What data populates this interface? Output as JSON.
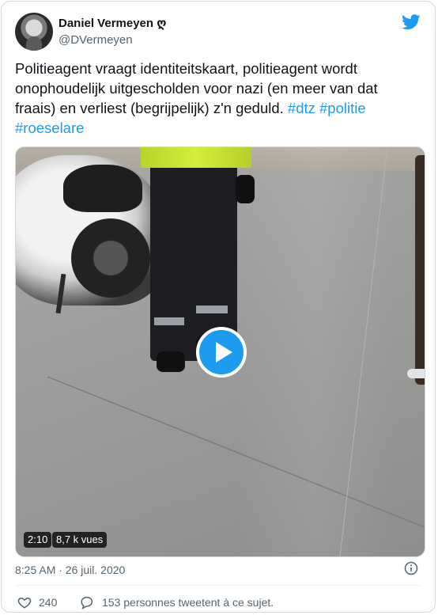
{
  "author": {
    "name": "Daniel Vermeyen",
    "name_glyph": "ღ",
    "handle": "@DVermeyen"
  },
  "tweet": {
    "text_lines": [
      "Politieagent vraagt identiteitskaart, politieagent wordt",
      "onophoudelijk uitgescholden voor nazi (en meer van dat",
      "fraais) en verliest (begrijpelijk) z'n geduld. "
    ],
    "hashtags": [
      "#dtz",
      "#politie",
      "#roeselare"
    ]
  },
  "media": {
    "duration": "2:10",
    "views": "8,7 k vues",
    "play_icon": "play-icon"
  },
  "meta": {
    "timestamp": "8:25 AM · 26 juil. 2020"
  },
  "actions": {
    "likes": "240",
    "conversation": "153 personnes tweetent à ce sujet."
  },
  "colors": {
    "accent": "#1d9bf0",
    "muted": "#536471"
  },
  "icons": [
    "twitter-bird-icon",
    "info-icon",
    "heart-icon",
    "reply-bubble-icon"
  ]
}
